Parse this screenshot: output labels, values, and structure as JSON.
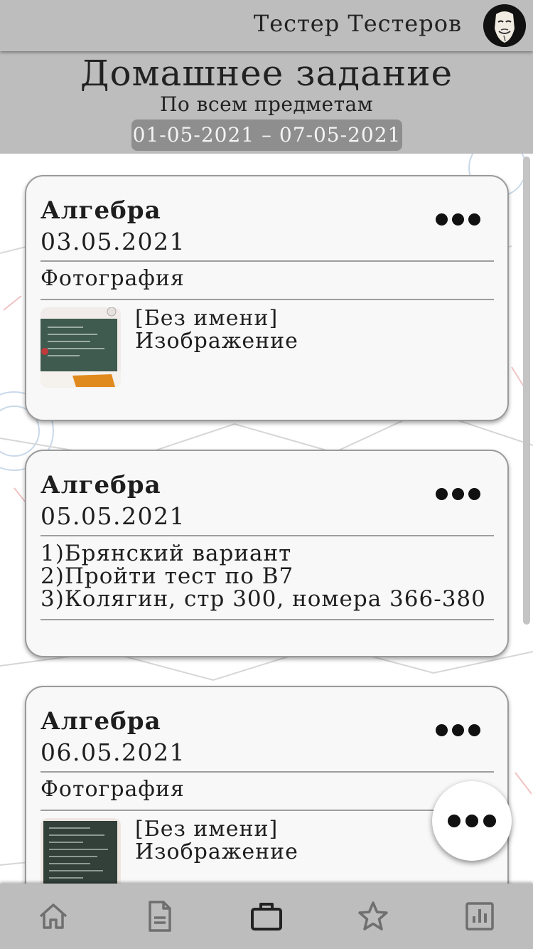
{
  "user": {
    "name": "Тестер Тестеров",
    "avatar_icon": "mask-avatar-icon"
  },
  "header": {
    "title": "Домашнее задание",
    "subtitle": "По всем предметам",
    "date_range": "01-05-2021 – 07-05-2021"
  },
  "cards": [
    {
      "subject": "Алгебра",
      "date": "03.05.2021",
      "section": "Фотография",
      "attachment": {
        "name": "[Без имени]",
        "type": "Изображение"
      }
    },
    {
      "subject": "Алгебра",
      "date": "05.05.2021",
      "tasks": [
        "1)Брянский вариант",
        "2)Пройти тест по В7",
        "3)Колягин, стр 300, номера 366-380"
      ]
    },
    {
      "subject": "Алгебра",
      "date": "06.05.2021",
      "section": "Фотография",
      "attachment": {
        "name": "[Без имени]",
        "type": "Изображение"
      }
    }
  ],
  "nav": [
    {
      "icon": "home-icon",
      "active": false
    },
    {
      "icon": "document-icon",
      "active": false
    },
    {
      "icon": "briefcase-icon",
      "active": true
    },
    {
      "icon": "star-icon",
      "active": false
    },
    {
      "icon": "chart-icon",
      "active": false
    }
  ],
  "colors": {
    "bar": "#bdbdbd",
    "card": "#f8f8f8",
    "date_pill": "#8e8e8e",
    "icon_inactive": "#6f6f6f",
    "icon_active": "#222222"
  }
}
